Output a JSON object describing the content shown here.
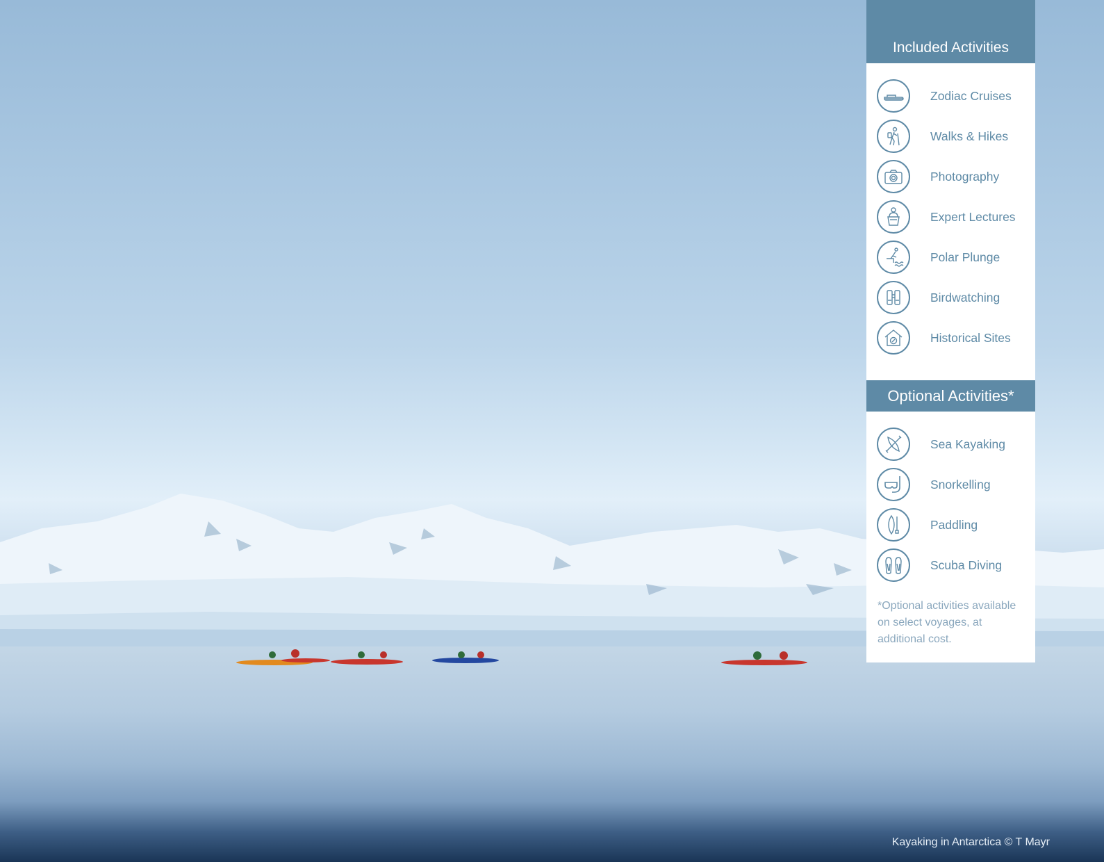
{
  "panel": {
    "included_title": "Included Activities",
    "included": [
      {
        "label": "Zodiac Cruises",
        "icon": "zodiac-boat-icon"
      },
      {
        "label": "Walks & Hikes",
        "icon": "hiker-icon"
      },
      {
        "label": "Photography",
        "icon": "camera-icon"
      },
      {
        "label": "Expert Lectures",
        "icon": "lecturer-podium-icon"
      },
      {
        "label": "Polar Plunge",
        "icon": "diver-plunge-icon"
      },
      {
        "label": "Birdwatching",
        "icon": "binoculars-icon"
      },
      {
        "label": "Historical Sites",
        "icon": "historic-house-icon"
      }
    ],
    "optional_title": "Optional Activities*",
    "optional": [
      {
        "label": "Sea Kayaking",
        "icon": "kayak-paddle-icon"
      },
      {
        "label": "Snorkelling",
        "icon": "snorkel-mask-icon"
      },
      {
        "label": "Paddling",
        "icon": "paddleboard-icon"
      },
      {
        "label": "Scuba Diving",
        "icon": "flippers-icon"
      }
    ],
    "footnote": "*Optional activities available on select voyages, at additional cost."
  },
  "photo": {
    "caption": "Kayaking in Antarctica © T Mayr"
  },
  "colors": {
    "accent": "#5e8aa6",
    "panel_bg": "#ffffff",
    "footnote": "#8aa7bd"
  }
}
